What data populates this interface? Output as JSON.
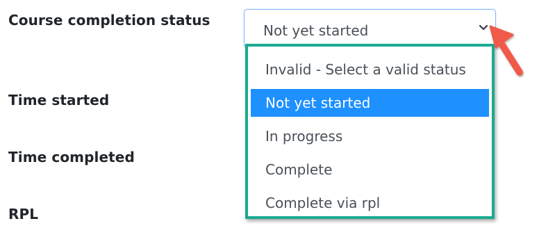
{
  "form": {
    "labels": {
      "course_completion_status": "Course completion status",
      "time_started": "Time started",
      "time_completed": "Time completed",
      "rpl": "RPL"
    }
  },
  "status_select": {
    "selected_value": "Not yet started",
    "icon": "chevron-down-icon",
    "options": [
      {
        "label": "Invalid - Select a valid status",
        "selected": false
      },
      {
        "label": "Not yet started",
        "selected": true
      },
      {
        "label": "In progress",
        "selected": false
      },
      {
        "label": "Complete",
        "selected": false
      },
      {
        "label": "Complete via rpl",
        "selected": false
      }
    ]
  },
  "annotations": {
    "arrow_color": "#f05a48",
    "highlight_border_color": "#1aaa8f",
    "selected_option_bg": "#1e90ff"
  }
}
